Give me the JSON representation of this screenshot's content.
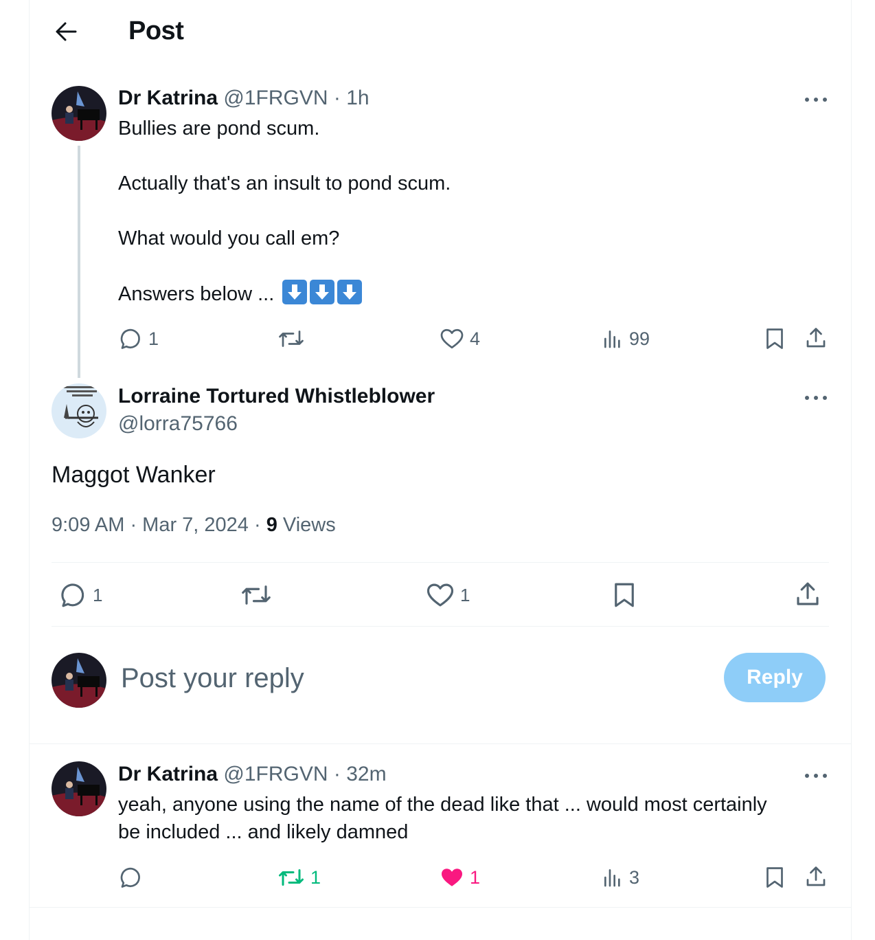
{
  "header": {
    "title": "Post"
  },
  "parent_post": {
    "author_name": "Dr Katrina",
    "handle": "@1FRGVN",
    "time": "· 1h",
    "lines": [
      "Bullies are pond scum.",
      "Actually that's an insult to pond scum.",
      "What would you call em?",
      "Answers below ..."
    ],
    "emoji": [
      "down-arrow-emoji",
      "down-arrow-emoji",
      "down-arrow-emoji"
    ],
    "stats": {
      "replies": "1",
      "retweets": "",
      "likes": "4",
      "views": "99"
    }
  },
  "main_post": {
    "author_name": "Lorraine Tortured Whistleblower",
    "handle": "@lorra75766",
    "text": "Maggot Wanker",
    "timestamp": "9:09 AM · Mar 7, 2024 ·",
    "views_count": "9",
    "views_label": "Views",
    "stats": {
      "replies": "1",
      "retweets": "",
      "likes": "1"
    }
  },
  "composer": {
    "placeholder": "Post your reply",
    "button_label": "Reply"
  },
  "reply_post": {
    "author_name": "Dr Katrina",
    "handle": "@1FRGVN",
    "time": "· 32m",
    "line1": "yeah, anyone using the name of the dead like that ... would most certainly",
    "line2": "be included ... and likely damned",
    "stats": {
      "replies": "",
      "retweets": "1",
      "likes": "1",
      "views": "3"
    }
  },
  "colors": {
    "muted": "#536471",
    "retweet_active": "#00ba7c",
    "like_active": "#f91880",
    "reply_button": "#8ecdf8",
    "emoji_blue": "#3b87d6"
  }
}
